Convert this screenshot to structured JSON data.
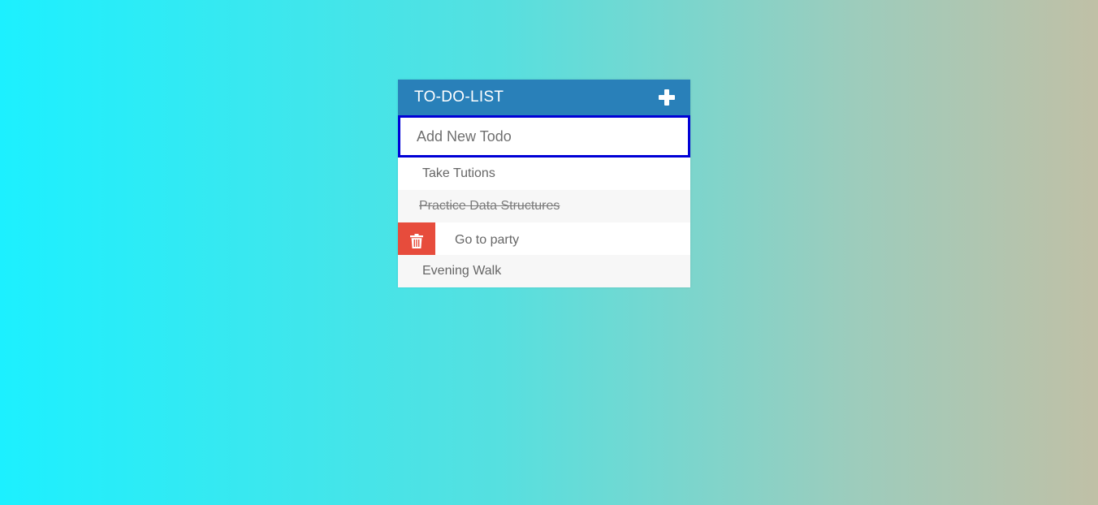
{
  "header": {
    "title": "TO-DO-LIST",
    "add_icon": "plus-icon"
  },
  "input": {
    "placeholder": "Add New Todo",
    "value": ""
  },
  "todos": [
    {
      "text": "Take Tutions",
      "completed": false
    },
    {
      "text": "Practice Data Structures",
      "completed": true
    },
    {
      "text": "Go to party",
      "completed": false,
      "hovered": true
    },
    {
      "text": "Evening Walk",
      "completed": false
    }
  ],
  "delete_icon": "trash-icon",
  "colors": {
    "header_bg": "#2980b9",
    "delete_bg": "#e74c3c",
    "input_border": "#0000d6",
    "bg_gradient_start": "#1cf0ff",
    "bg_gradient_end": "#c0c0a6"
  }
}
